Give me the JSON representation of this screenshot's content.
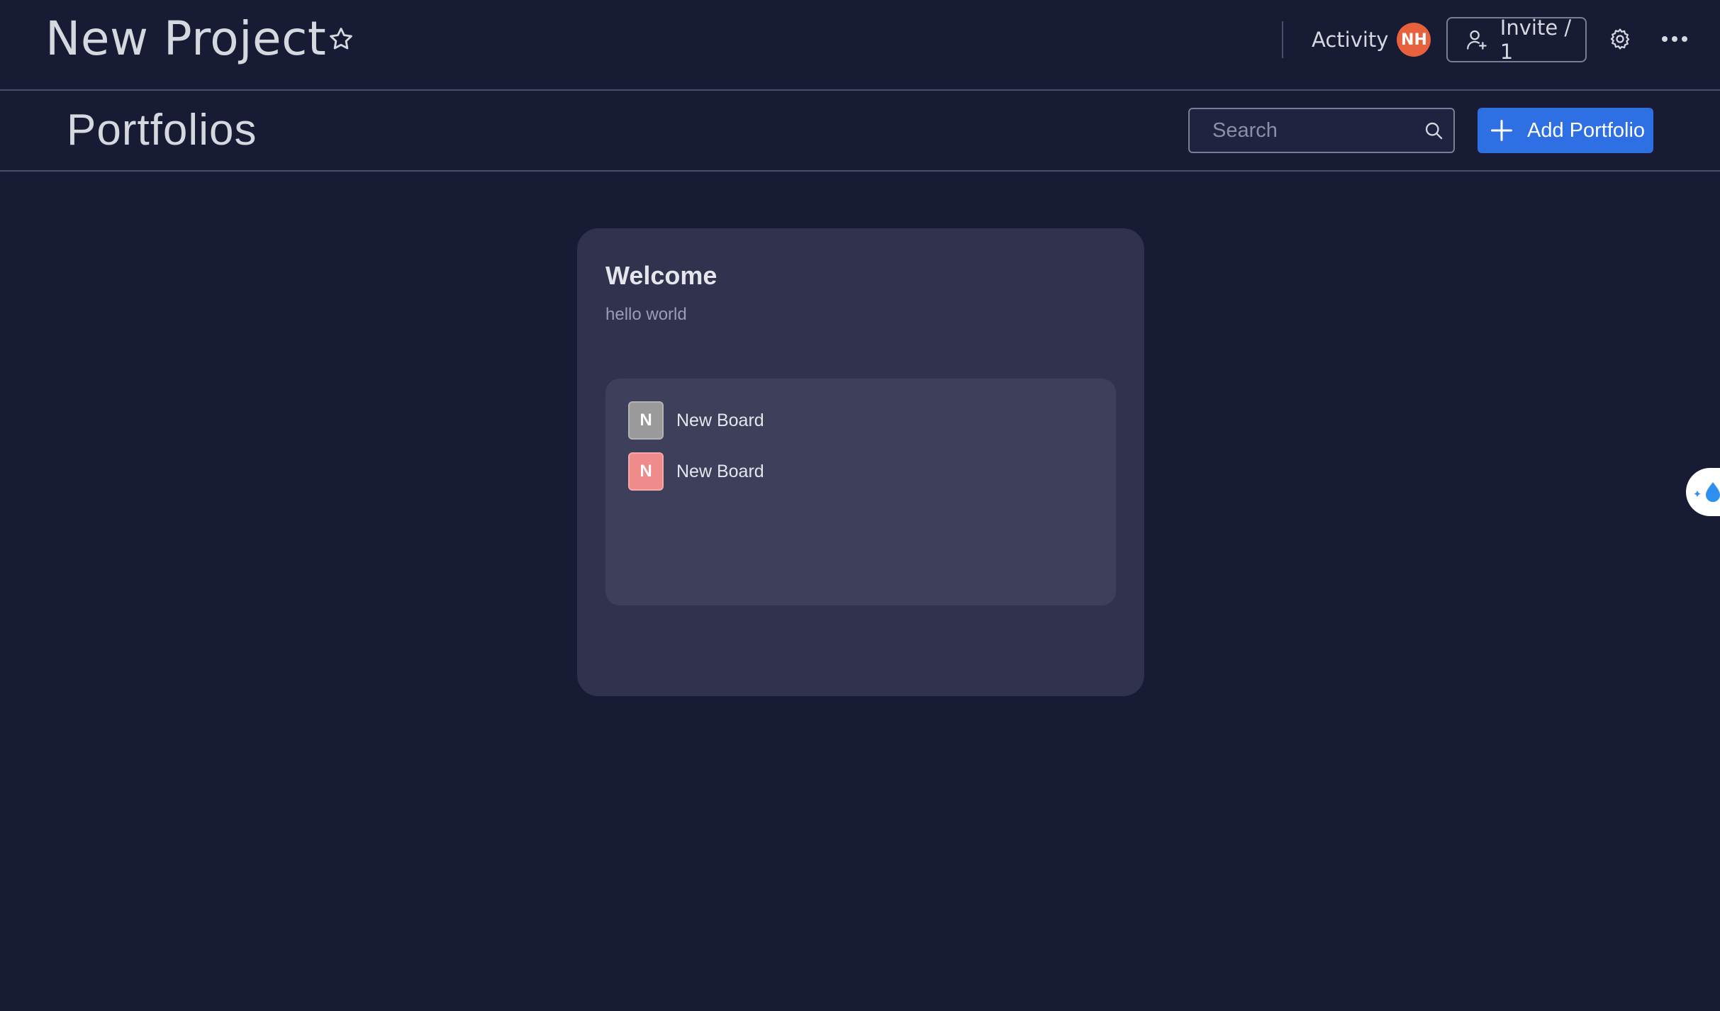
{
  "header": {
    "project_title": "New Project",
    "activity_label": "Activity",
    "avatar_initials": "NH",
    "invite_label": "Invite / 1"
  },
  "subheader": {
    "page_title": "Portfolios",
    "search_placeholder": "Search",
    "add_label": "Add Portfolio"
  },
  "portfolio": {
    "title": "Welcome",
    "description": "hello world",
    "boards": [
      {
        "initial": "N",
        "name": "New Board",
        "color": "#9a9a9a"
      },
      {
        "initial": "N",
        "name": "New Board",
        "color": "#f08b8b"
      }
    ]
  },
  "colors": {
    "background": "#181b34",
    "card": "#30324e",
    "accent": "#2f6fe4",
    "avatar": "#e8613d"
  }
}
